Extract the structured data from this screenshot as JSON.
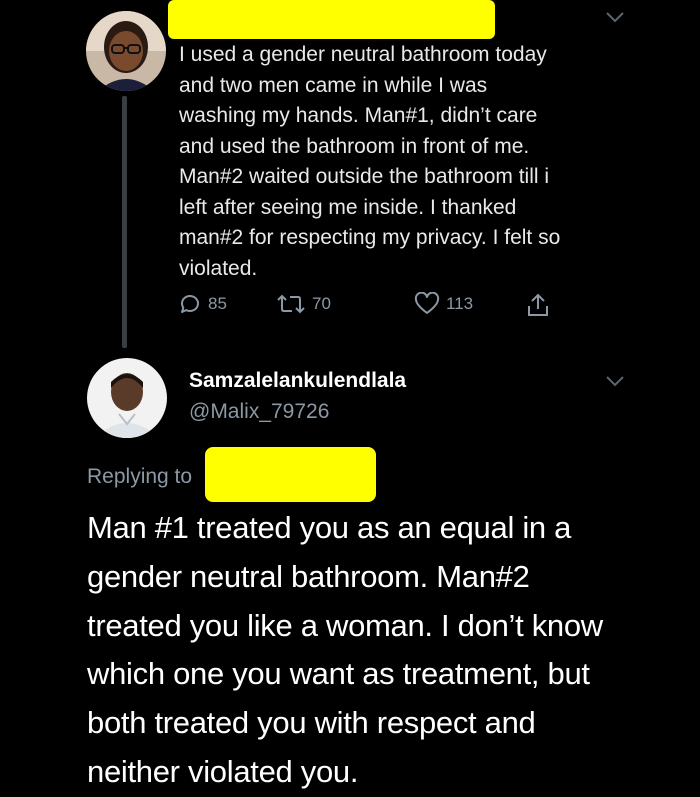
{
  "original_tweet": {
    "text": "I used a gender neutral bathroom today\nand two men came in while I was\nwashing my hands. Man#1, didn’t care\nand used the bathroom in front of me.\nMan#2 waited outside the bathroom till i\nleft after seeing me inside. I thanked\nman#2 for respecting my privacy. I felt so\nviolated.",
    "reply_count": "85",
    "retweet_count": "70",
    "like_count": "113",
    "author_redacted": true,
    "icons": [
      "reply-icon",
      "retweet-icon",
      "like-icon",
      "share-icon",
      "chevron-down-icon"
    ]
  },
  "reply_tweet": {
    "display_name": "Samzalelankulendlala",
    "handle": "@Malix_79726",
    "replying_to_label": "Replying to",
    "text": "Man #1 treated you as an equal in a\ngender neutral bathroom. Man#2\ntreated you like a woman. I don’t know\nwhich one you want as treatment, but\nboth treated you with respect and\nneither violated you."
  },
  "colors": {
    "background": "#000000",
    "primary_text": "#e7e9ea",
    "secondary_text": "#8b98a5",
    "redaction": "#ffff00",
    "thread_line": "#3a3d41"
  }
}
